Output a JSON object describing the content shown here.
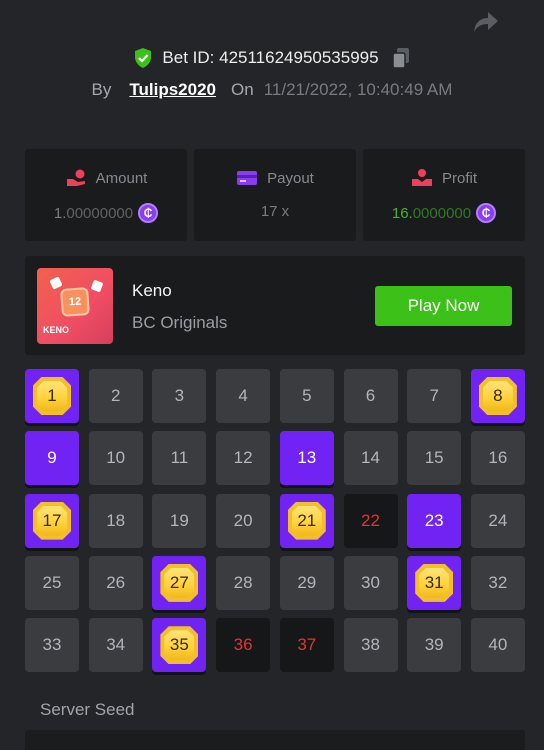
{
  "header": {
    "bet_id_text": "Bet ID: 42511624950535995",
    "by_label": "By",
    "username": "Tulips2020",
    "on_label": "On",
    "datetime": "11/21/2022, 10:40:49 AM"
  },
  "stats": {
    "amount": {
      "label": "Amount",
      "value_lead": "1.",
      "value_rest": "00000000",
      "coin_symbol": "₵"
    },
    "payout": {
      "label": "Payout",
      "value": "17 x"
    },
    "profit": {
      "label": "Profit",
      "value_lead": "16.",
      "value_rest": "0000000",
      "coin_symbol": "₵"
    }
  },
  "game": {
    "name": "Keno",
    "provider": "BC Originals",
    "play_label": "Play Now",
    "thumb_ball": "12",
    "thumb_tag": "KENO"
  },
  "keno": {
    "columns": 8,
    "cells": [
      {
        "n": "1",
        "state": "hit"
      },
      {
        "n": "2",
        "state": "idle"
      },
      {
        "n": "3",
        "state": "idle"
      },
      {
        "n": "4",
        "state": "idle"
      },
      {
        "n": "5",
        "state": "idle"
      },
      {
        "n": "6",
        "state": "idle"
      },
      {
        "n": "7",
        "state": "idle"
      },
      {
        "n": "8",
        "state": "hit"
      },
      {
        "n": "9",
        "state": "picked"
      },
      {
        "n": "10",
        "state": "idle"
      },
      {
        "n": "11",
        "state": "idle"
      },
      {
        "n": "12",
        "state": "idle"
      },
      {
        "n": "13",
        "state": "picked"
      },
      {
        "n": "14",
        "state": "idle"
      },
      {
        "n": "15",
        "state": "idle"
      },
      {
        "n": "16",
        "state": "idle"
      },
      {
        "n": "17",
        "state": "hit"
      },
      {
        "n": "18",
        "state": "idle"
      },
      {
        "n": "19",
        "state": "idle"
      },
      {
        "n": "20",
        "state": "idle"
      },
      {
        "n": "21",
        "state": "hit"
      },
      {
        "n": "22",
        "state": "miss"
      },
      {
        "n": "23",
        "state": "picked"
      },
      {
        "n": "24",
        "state": "idle"
      },
      {
        "n": "25",
        "state": "idle"
      },
      {
        "n": "26",
        "state": "idle"
      },
      {
        "n": "27",
        "state": "hit"
      },
      {
        "n": "28",
        "state": "idle"
      },
      {
        "n": "29",
        "state": "idle"
      },
      {
        "n": "30",
        "state": "idle"
      },
      {
        "n": "31",
        "state": "hit"
      },
      {
        "n": "32",
        "state": "idle"
      },
      {
        "n": "33",
        "state": "idle"
      },
      {
        "n": "34",
        "state": "idle"
      },
      {
        "n": "35",
        "state": "hit"
      },
      {
        "n": "36",
        "state": "miss"
      },
      {
        "n": "37",
        "state": "miss"
      },
      {
        "n": "38",
        "state": "idle"
      },
      {
        "n": "39",
        "state": "idle"
      },
      {
        "n": "40",
        "state": "idle"
      }
    ]
  },
  "seed": {
    "label": "Server Seed"
  },
  "colors": {
    "background": "#232528",
    "accent_purple": "#7023f2",
    "play_green": "#3bc117",
    "miss_red": "#e0372f",
    "gem_gold": "#ffd33d"
  },
  "icons": {
    "share": "share-arrow-icon",
    "verified": "shield-check-icon",
    "copy": "copy-icon",
    "amount": "coins-hand-icon",
    "payout": "card-icon",
    "profit": "money-hand-icon",
    "currency": "bc-coin-icon"
  }
}
